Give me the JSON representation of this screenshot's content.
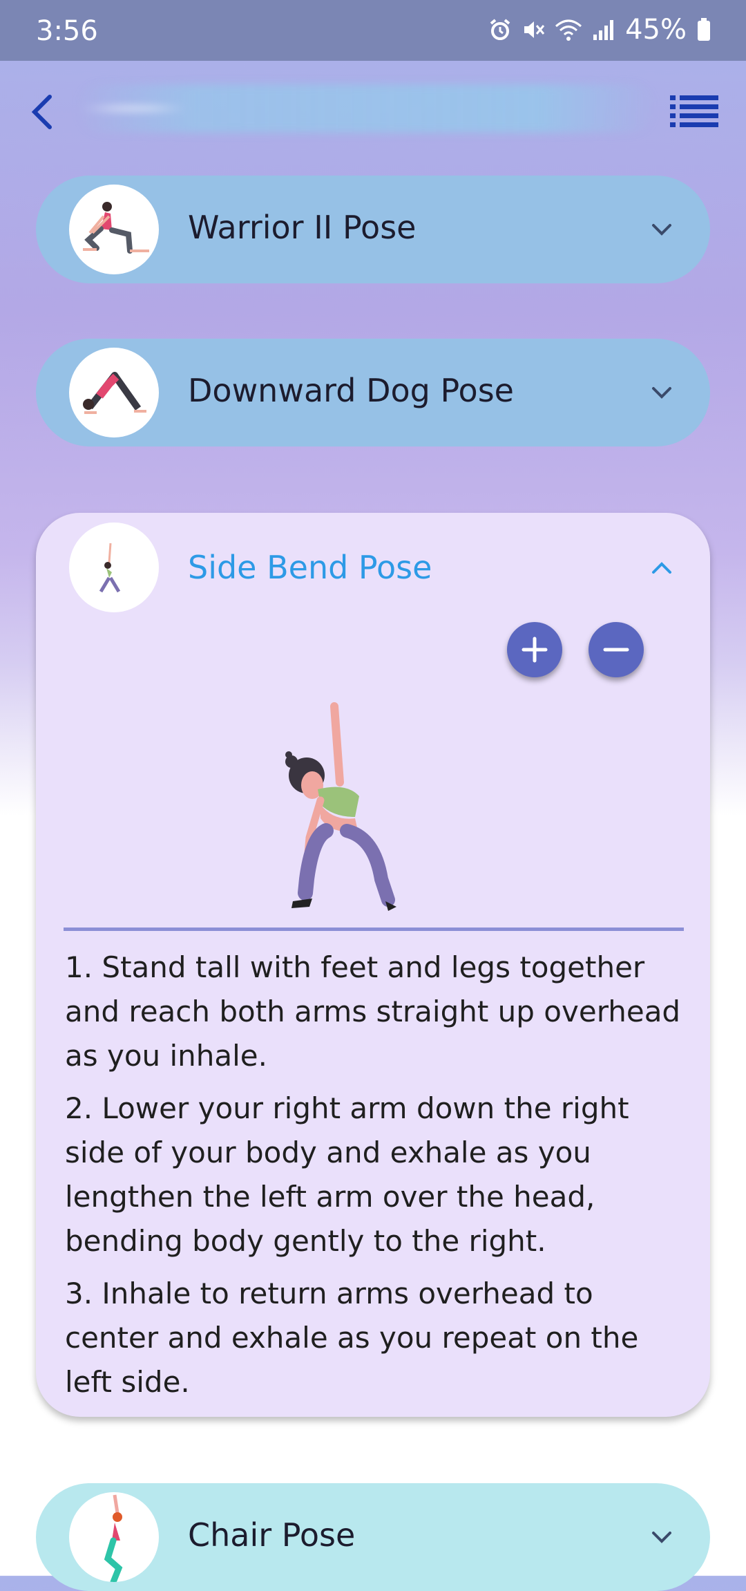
{
  "status_bar": {
    "time": "3:56",
    "battery": "45%"
  },
  "header": {
    "back_icon": "chevron-left-icon",
    "menu_icon": "list-icon"
  },
  "poses": [
    {
      "name": "Warrior II Pose",
      "expanded": false
    },
    {
      "name": "Downward Dog Pose",
      "expanded": false
    },
    {
      "name": "Side Bend Pose",
      "expanded": true
    },
    {
      "name": "Chair Pose",
      "expanded": false
    }
  ],
  "expanded": {
    "zoom_in_icon": "plus-icon",
    "zoom_out_icon": "minus-icon",
    "steps": [
      "1. Stand tall with feet and legs together and reach both arms straight up overhead as you inhale.",
      "2. Lower your right arm down the right side of your body and exhale as you lengthen the left arm over the head, bending body gently to the right.",
      "3. Inhale to return arms overhead to center and exhale as you repeat on the left side."
    ]
  },
  "colors": {
    "card_blue": "#96c1e6",
    "card_expanded": "#eae0fb",
    "card_teal": "#b8e8ee",
    "accent_title": "#2d9ae6",
    "button": "#5b67c0",
    "nav_icon": "#1a3cb0"
  }
}
